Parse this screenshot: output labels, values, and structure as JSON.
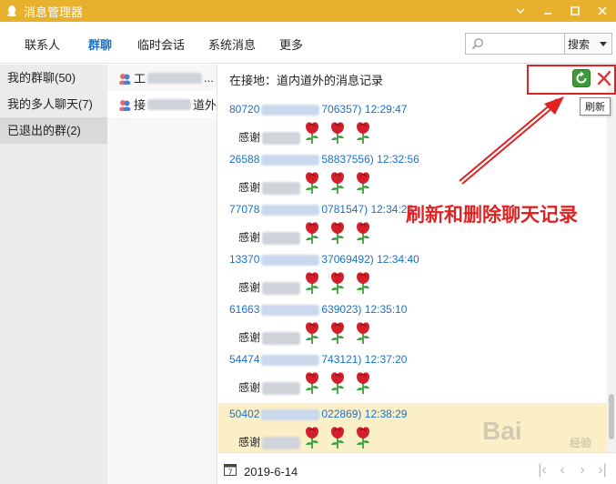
{
  "window": {
    "title": "消息管理器"
  },
  "nav": {
    "tabs": [
      {
        "label": "联系人",
        "active": false
      },
      {
        "label": "群聊",
        "active": true
      },
      {
        "label": "临时会话",
        "active": false
      },
      {
        "label": "系统消息",
        "active": false
      },
      {
        "label": "更多",
        "active": false
      }
    ],
    "search_value": "",
    "search_button": "搜索"
  },
  "sidebar": {
    "items": [
      {
        "label": "我的群聊(50)",
        "selected": false
      },
      {
        "label": "我的多人聊天(7)",
        "selected": false
      },
      {
        "label": "已退出的群(2)",
        "selected": true
      }
    ]
  },
  "group_list": {
    "items": [
      {
        "prefix": "工",
        "suffix": "...",
        "selected": false
      },
      {
        "prefix": "接",
        "suffix": "道外",
        "selected": true
      }
    ]
  },
  "main": {
    "location": "在接地：道内道外的消息记录",
    "tooltip": "刷新",
    "messages": [
      {
        "id_start": "80720",
        "id_end": "706357)",
        "time": "12:29:47",
        "body": "感谢",
        "highlight": false
      },
      {
        "id_start": "26588",
        "id_end": "58837556)",
        "time": "12:32:56",
        "body": "感谢",
        "highlight": false
      },
      {
        "id_start": "77078",
        "id_end": "0781547)",
        "time": "12:34:25",
        "body": "感谢",
        "highlight": false
      },
      {
        "id_start": "13370",
        "id_end": "37069492)",
        "time": "12:34:40",
        "body": "感谢",
        "highlight": false
      },
      {
        "id_start": "61663",
        "id_end": "639023)",
        "time": "12:35:10",
        "body": "感谢",
        "highlight": false
      },
      {
        "id_start": "54474",
        "id_end": "743121)",
        "time": "12:37:20",
        "body": "感谢",
        "highlight": false
      },
      {
        "id_start": "50402",
        "id_end": "022869)",
        "time": "12:38:29",
        "body": "感谢",
        "highlight": true
      }
    ],
    "date": "2019-6-14"
  },
  "annotation": {
    "text": "刷新和删除聊天记录"
  },
  "watermark": {
    "text": "Bai",
    "sub": "经验"
  },
  "colors": {
    "titlebar": "#e8b12d",
    "accent": "#1a70c8",
    "annotation": "#e02222",
    "highlight": "#fbefc8"
  }
}
